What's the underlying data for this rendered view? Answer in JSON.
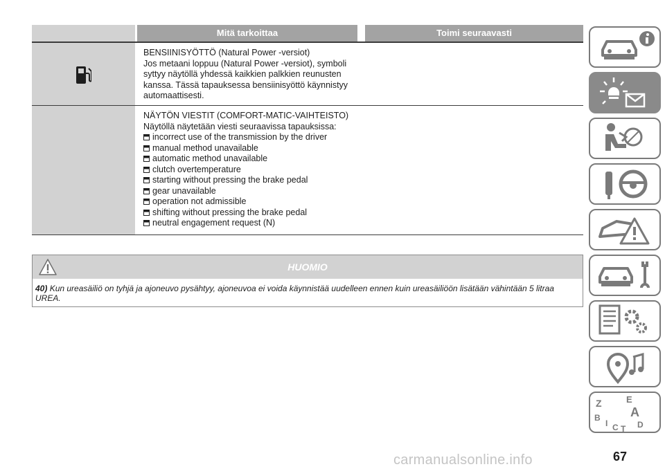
{
  "table": {
    "header": {
      "col_meaning": "Mitä tarkoittaa",
      "col_action": "Toimi seuraavasti"
    },
    "row1": {
      "icon": "fuel-pump-icon",
      "lines": [
        "BENSIINISYÖTTÖ (Natural Power -versiot)",
        "Jos metaani loppuu (Natural Power -versiot), symboli",
        "syttyy näytöllä yhdessä kaikkien palkkien reunusten",
        "kanssa. Tässä tapauksessa bensiinisyöttö käynnistyy",
        "automaattisesti."
      ]
    },
    "row2": {
      "lines": [
        "NÄYTÖN VIESTIT (COMFORT-MATIC-VAIHTEISTO)",
        "Näytöllä näytetään viesti seuraavissa tapauksissa:"
      ],
      "bullets": [
        "incorrect use of the transmission by the driver",
        "manual method unavailable",
        "automatic method unavailable",
        "clutch overtemperature",
        "starting without pressing the brake pedal",
        "gear unavailable",
        "operation not admissible",
        "shifting without pressing the brake pedal",
        "neutral engagement request (N)"
      ]
    }
  },
  "warning": {
    "title": "HUOMIO",
    "number": "40)",
    "text": "Kun ureasäiliö on tyhjä ja ajoneuvo pysähtyy, ajoneuvoa ei voida käynnistää uudelleen ennen kuin ureasäiliöön lisätään vähintään 5 litraa",
    "text2": "UREA."
  },
  "side_tabs": [
    {
      "icon": "car-info-icon",
      "active": false
    },
    {
      "icon": "warning-light-message-icon",
      "active": true
    },
    {
      "icon": "seat-airbag-icon",
      "active": false
    },
    {
      "icon": "key-steering-wheel-icon",
      "active": false
    },
    {
      "icon": "car-crash-warning-icon",
      "active": false
    },
    {
      "icon": "car-wrench-icon",
      "active": false
    },
    {
      "icon": "document-gears-icon",
      "active": false
    },
    {
      "icon": "navigation-music-icon",
      "active": false
    },
    {
      "icon": "alphabet-index-icon",
      "active": false
    }
  ],
  "page_number": "67",
  "watermark": "carmanualsonline.info",
  "colors": {
    "header_grey": "#a3a3a3",
    "cell_grey": "#d2d2d2",
    "tab_active": "#8a8a8a"
  }
}
